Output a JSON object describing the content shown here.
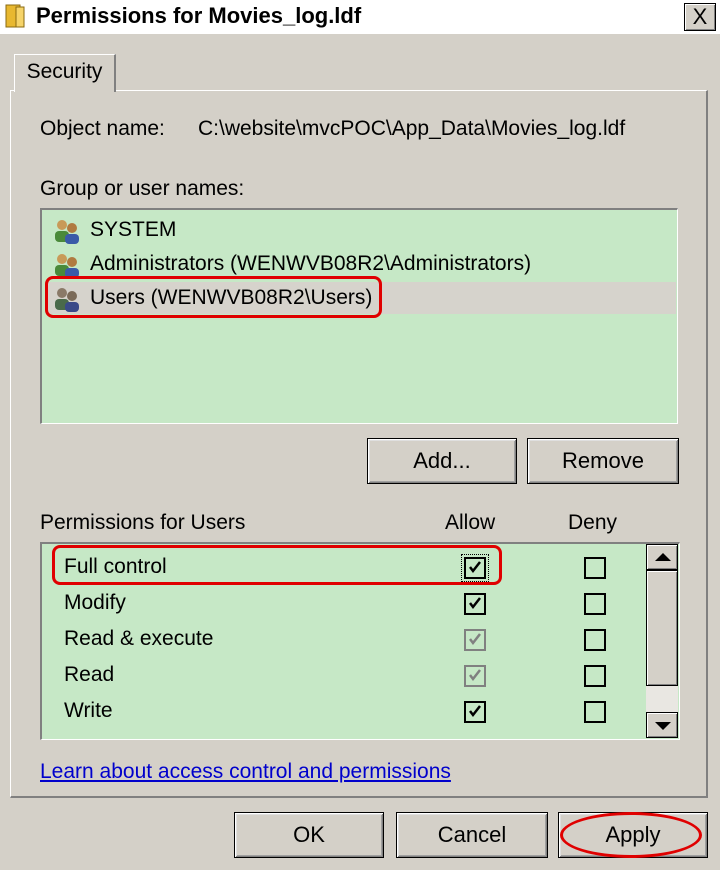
{
  "window": {
    "title": "Permissions for Movies_log.ldf",
    "close_label": "X",
    "folder_icon_color": "#e8b830"
  },
  "tabs": [
    {
      "label": "Security",
      "selected": true
    }
  ],
  "object": {
    "label": "Object name:",
    "value": "C:\\website\\mvcPOC\\App_Data\\Movies_log.ldf"
  },
  "groups": {
    "label": "Group or user names:",
    "items": [
      {
        "name": "SYSTEM",
        "icon": "users-group-icon",
        "selected": false
      },
      {
        "name": "Administrators (WENWVB08R2\\Administrators)",
        "icon": "users-group-icon",
        "selected": false
      },
      {
        "name": "Users (WENWVB08R2\\Users)",
        "icon": "users-group-icon",
        "selected": true
      }
    ],
    "add_label": "Add...",
    "remove_label": "Remove"
  },
  "permissions": {
    "label": "Permissions for Users",
    "allow_header": "Allow",
    "deny_header": "Deny",
    "rows": [
      {
        "name": "Full control",
        "allow": true,
        "allow_inherited": false,
        "deny": false,
        "focused": true
      },
      {
        "name": "Modify",
        "allow": true,
        "allow_inherited": false,
        "deny": false
      },
      {
        "name": "Read & execute",
        "allow": true,
        "allow_inherited": true,
        "deny": false
      },
      {
        "name": "Read",
        "allow": true,
        "allow_inherited": true,
        "deny": false
      },
      {
        "name": "Write",
        "allow": true,
        "allow_inherited": false,
        "deny": false
      }
    ]
  },
  "link_text": "Learn about access control and permissions",
  "buttons": {
    "ok": "OK",
    "cancel": "Cancel",
    "apply": "Apply"
  },
  "colors": {
    "list_background": "#c6e8c6",
    "selected_row": "#d6d3cc",
    "annotation_red": "#e00000",
    "link_blue": "#0000cc"
  }
}
